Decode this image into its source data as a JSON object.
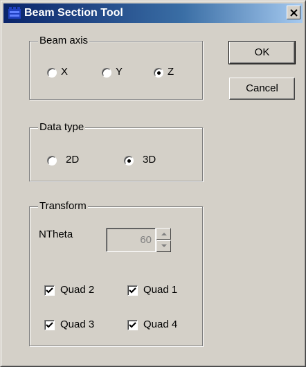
{
  "window": {
    "title": "Beam Section Tool",
    "close_glyph": "✕"
  },
  "beam_axis": {
    "legend": "Beam axis",
    "options": [
      {
        "label": "X",
        "selected": false
      },
      {
        "label": "Y",
        "selected": false
      },
      {
        "label": "Z",
        "selected": true
      }
    ]
  },
  "data_type": {
    "legend": "Data type",
    "options": [
      {
        "label": "2D",
        "selected": false
      },
      {
        "label": "3D",
        "selected": true
      }
    ]
  },
  "transform": {
    "legend": "Transform",
    "ntheta_label": "NTheta",
    "ntheta_value": "60",
    "ntheta_enabled": false,
    "quads": [
      {
        "label": "Quad 2",
        "checked": true
      },
      {
        "label": "Quad 1",
        "checked": true
      },
      {
        "label": "Quad 3",
        "checked": true
      },
      {
        "label": "Quad 4",
        "checked": true
      }
    ]
  },
  "buttons": {
    "ok": "OK",
    "cancel": "Cancel"
  },
  "icons": {
    "title_icon": "beam-tool-icon",
    "spin_up": "spin-up-arrow-icon",
    "spin_down": "spin-down-arrow-icon"
  },
  "colors": {
    "titlebar_start": "#0a246a",
    "titlebar_end": "#a6caf0",
    "face": "#d4d0c8"
  }
}
